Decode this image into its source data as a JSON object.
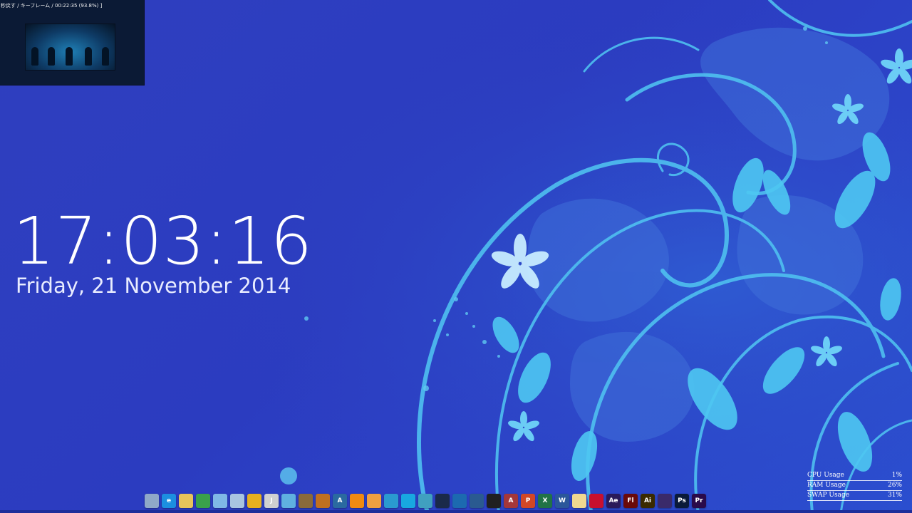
{
  "video_preview": {
    "status_text": "秒戻す / キーフレーム / 00:22:35 (93.8%) ]"
  },
  "clock": {
    "time": "17:03:16",
    "date": "Friday, 21 November 2014"
  },
  "dock": {
    "items": [
      {
        "name": "recycle-bin-icon",
        "color": "#8fa8c8",
        "glyph": ""
      },
      {
        "name": "internet-explorer-icon",
        "color": "#1c8fe0",
        "glyph": "e"
      },
      {
        "name": "folder-icon",
        "color": "#e8c45a",
        "glyph": ""
      },
      {
        "name": "mail-icon",
        "color": "#3aa14a",
        "glyph": ""
      },
      {
        "name": "notepad-icon",
        "color": "#7fb8e6",
        "glyph": ""
      },
      {
        "name": "app-window-icon",
        "color": "#a8c4e0",
        "glyph": ""
      },
      {
        "name": "file-manager-icon",
        "color": "#e6b020",
        "glyph": ""
      },
      {
        "name": "j-app-icon",
        "color": "#d0d0d0",
        "glyph": "J"
      },
      {
        "name": "chat-icon",
        "color": "#5fb0e0",
        "glyph": ""
      },
      {
        "name": "gimp-icon",
        "color": "#8a6a3a",
        "glyph": ""
      },
      {
        "name": "game-icon",
        "color": "#c07020",
        "glyph": ""
      },
      {
        "name": "a-app-icon",
        "color": "#2a6aa0",
        "glyph": "A"
      },
      {
        "name": "orange-ball-icon",
        "color": "#f08a10",
        "glyph": ""
      },
      {
        "name": "media-player-icon",
        "color": "#f0a040",
        "glyph": ""
      },
      {
        "name": "globe-icon",
        "color": "#2a9ad0",
        "glyph": ""
      },
      {
        "name": "snowflake-icon",
        "color": "#18a8e0",
        "glyph": ""
      },
      {
        "name": "chrome-like-icon",
        "color": "#40a0c0",
        "glyph": ""
      },
      {
        "name": "steam-icon",
        "color": "#1a2a4a",
        "glyph": ""
      },
      {
        "name": "windows-live-icon",
        "color": "#1c6ab0",
        "glyph": ""
      },
      {
        "name": "torrent-icon",
        "color": "#2a5a90",
        "glyph": ""
      },
      {
        "name": "terminal-icon",
        "color": "#202020",
        "glyph": ""
      },
      {
        "name": "access-icon",
        "color": "#a4373a",
        "glyph": "A"
      },
      {
        "name": "powerpoint-icon",
        "color": "#d24726",
        "glyph": "P"
      },
      {
        "name": "excel-icon",
        "color": "#217346",
        "glyph": "X"
      },
      {
        "name": "word-icon",
        "color": "#2b579a",
        "glyph": "W"
      },
      {
        "name": "document-icon",
        "color": "#f0d890",
        "glyph": ""
      },
      {
        "name": "acrobat-icon",
        "color": "#c8102e",
        "glyph": ""
      },
      {
        "name": "after-effects-icon",
        "color": "#2a1a5a",
        "glyph": "Ae"
      },
      {
        "name": "flash-icon",
        "color": "#6a0a0a",
        "glyph": "Fl"
      },
      {
        "name": "illustrator-icon",
        "color": "#3a2a00",
        "glyph": "Ai"
      },
      {
        "name": "media-encoder-icon",
        "color": "#3a2a6a",
        "glyph": ""
      },
      {
        "name": "photoshop-icon",
        "color": "#0a1a3a",
        "glyph": "Ps"
      },
      {
        "name": "premiere-icon",
        "color": "#2a0a4a",
        "glyph": "Pr"
      }
    ]
  },
  "sysmon": {
    "rows": [
      {
        "label": "CPU Usage",
        "value": "1%"
      },
      {
        "label": "RAM Usage",
        "value": "26%"
      },
      {
        "label": "SWAP Usage",
        "value": "31%"
      }
    ]
  },
  "colors": {
    "wallpaper_base": "#2f3fbf",
    "floral_light": "#4fc8f2",
    "floral_mid": "#3a8fe0"
  }
}
